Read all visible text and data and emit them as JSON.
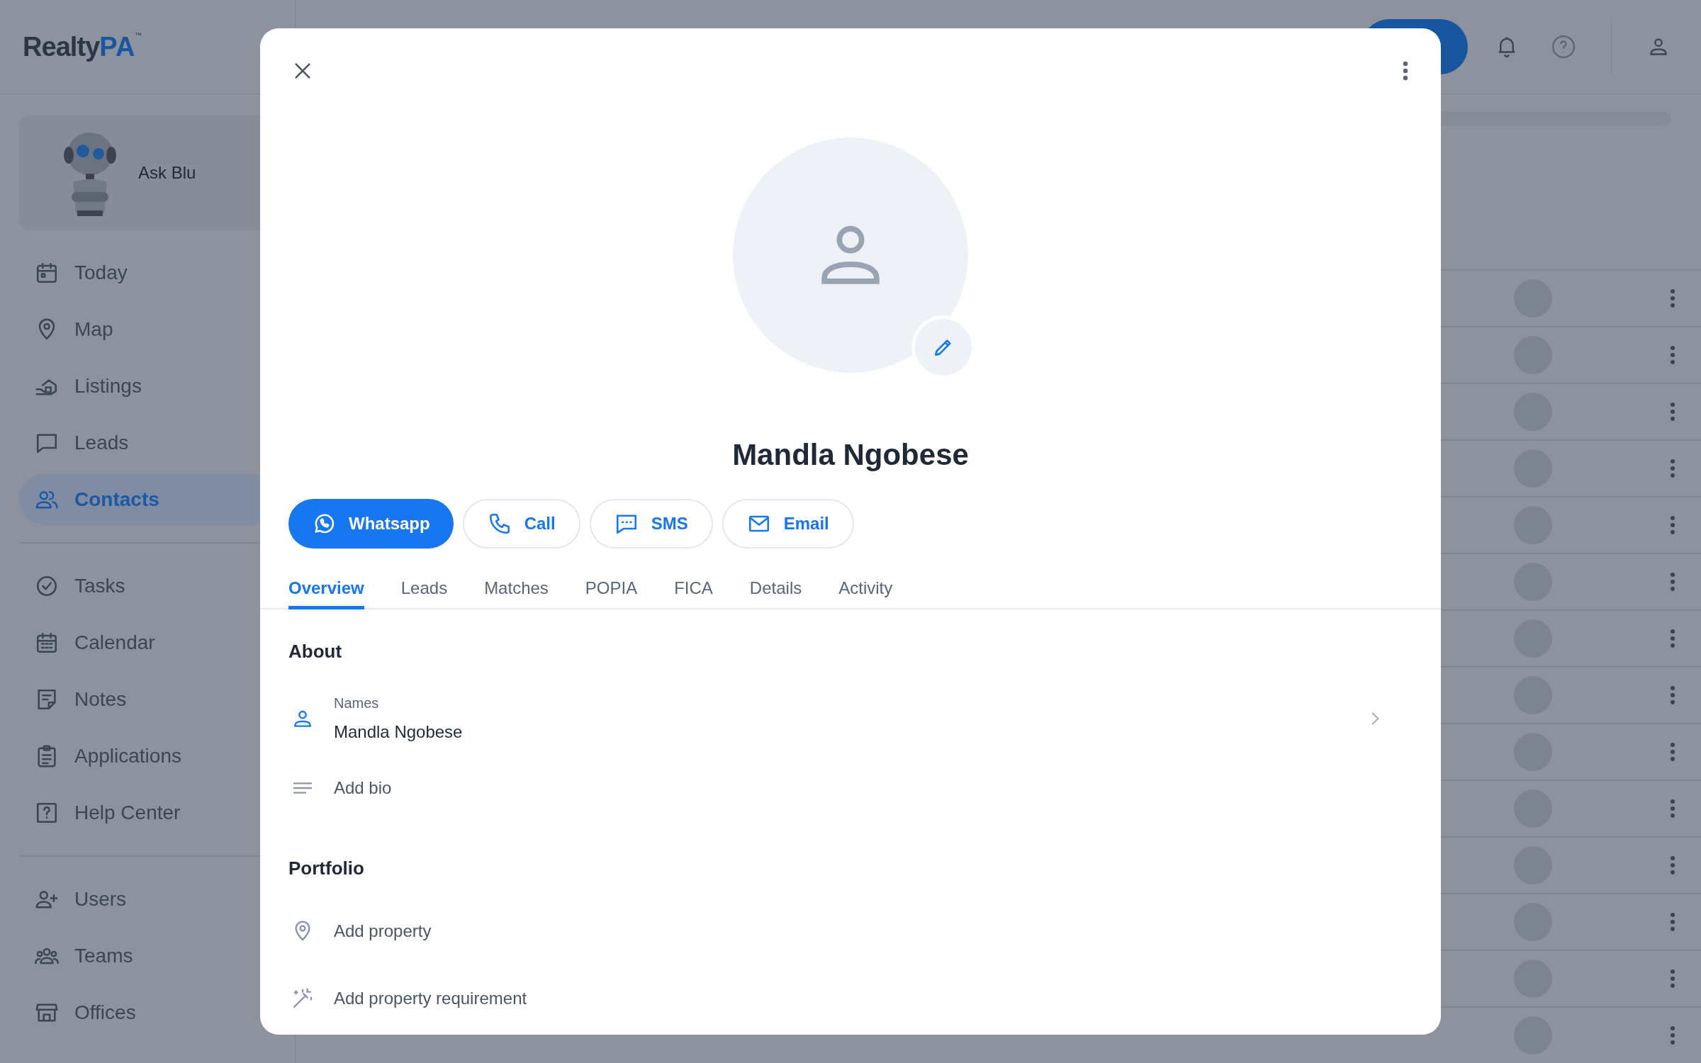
{
  "logo": {
    "name": "Realty",
    "accent": "PA",
    "mark": "™"
  },
  "sidebar": {
    "assistant": "Ask Blu",
    "groups": [
      [
        {
          "label": "Today",
          "selected": false
        },
        {
          "label": "Map",
          "selected": false
        },
        {
          "label": "Listings",
          "selected": false
        },
        {
          "label": "Leads",
          "selected": false
        },
        {
          "label": "Contacts",
          "selected": true
        }
      ],
      [
        {
          "label": "Tasks",
          "selected": false
        },
        {
          "label": "Calendar",
          "selected": false
        },
        {
          "label": "Notes",
          "selected": false
        },
        {
          "label": "Applications",
          "selected": false
        },
        {
          "label": "Help Center",
          "selected": false
        }
      ],
      [
        {
          "label": "Users",
          "selected": false
        },
        {
          "label": "Teams",
          "selected": false
        },
        {
          "label": "Offices",
          "selected": false
        }
      ]
    ]
  },
  "contact_dialog": {
    "name": "Mandla Ngobese",
    "actions": [
      {
        "label": "Whatsapp",
        "kind": "primary"
      },
      {
        "label": "Call",
        "kind": "outline"
      },
      {
        "label": "SMS",
        "kind": "outline"
      },
      {
        "label": "Email",
        "kind": "outline"
      }
    ],
    "tabs": [
      {
        "label": "Overview",
        "selected": true
      },
      {
        "label": "Leads",
        "selected": false
      },
      {
        "label": "Matches",
        "selected": false
      },
      {
        "label": "POPIA",
        "selected": false
      },
      {
        "label": "FICA",
        "selected": false
      },
      {
        "label": "Details",
        "selected": false
      },
      {
        "label": "Activity",
        "selected": false
      }
    ],
    "sections": [
      {
        "title": "About",
        "items": [
          {
            "kind": "field",
            "label": "Names",
            "value": "Mandla Ngobese"
          },
          {
            "kind": "add",
            "label": "Add bio"
          }
        ]
      },
      {
        "title": "Portfolio",
        "items": [
          {
            "kind": "add",
            "label": "Add property"
          },
          {
            "kind": "add",
            "label": "Add property requirement"
          }
        ]
      }
    ]
  }
}
